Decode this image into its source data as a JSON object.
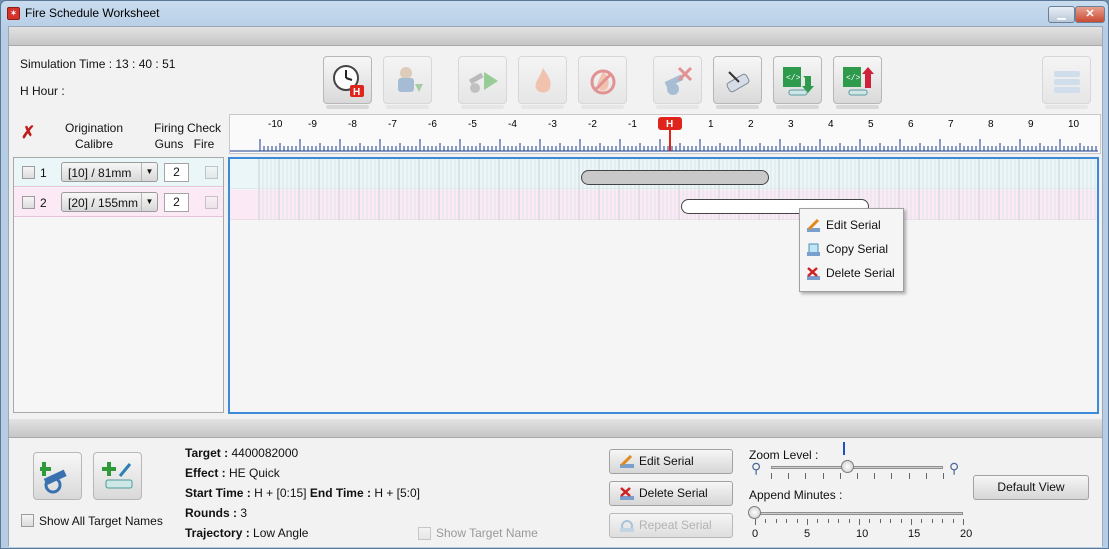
{
  "window": {
    "title": "Fire Schedule Worksheet"
  },
  "top_panel": {
    "simulation_time_label": "Simulation Time : 13 : 40 : 51",
    "h_hour_label": "H Hour :",
    "toolbar": [
      {
        "name": "h-hour-clock-button",
        "icon": "clock-h-icon",
        "enabled": true
      },
      {
        "name": "assign-observer-button",
        "icon": "soldier-download-icon",
        "enabled": false
      },
      {
        "name": "play-fire-button",
        "icon": "gun-play-icon",
        "enabled": false
      },
      {
        "name": "fire-button",
        "icon": "fire-icon",
        "enabled": false
      },
      {
        "name": "cease-fire-button",
        "icon": "no-fire-icon",
        "enabled": false
      },
      {
        "name": "cancel-gun-button",
        "icon": "gun-cancel-icon",
        "enabled": false
      },
      {
        "name": "edit-clear-button",
        "icon": "pencil-eraser-icon",
        "enabled": true
      },
      {
        "name": "xml-import-button",
        "icon": "xml-import-icon",
        "enabled": true
      },
      {
        "name": "xml-export-button",
        "icon": "xml-export-icon",
        "enabled": true
      },
      {
        "name": "layout-button",
        "icon": "layout-icon",
        "enabled": false
      }
    ]
  },
  "headers": {
    "origination": "Origination",
    "calibre": "Calibre",
    "firing": "Firing",
    "guns": "Guns",
    "check": "Check",
    "fire": "Fire"
  },
  "ruler": {
    "labels": [
      "-10",
      "-9",
      "-8",
      "-7",
      "-6",
      "-5",
      "-4",
      "-3",
      "-2",
      "-1",
      "",
      "1",
      "2",
      "3",
      "4",
      "5",
      "6",
      "7",
      "8",
      "9",
      "10"
    ],
    "h_marker": "H"
  },
  "rows": [
    {
      "num": "1",
      "calibre": "[10] / 81mm",
      "guns": "2",
      "serial_start": -2.2,
      "serial_end": 2.5
    },
    {
      "num": "2",
      "calibre": "[20] / 155mm",
      "guns": "2",
      "serial_start": 0.3,
      "serial_end": 5.0
    }
  ],
  "context_menu": {
    "edit": "Edit Serial",
    "copy": "Copy Serial",
    "delete": "Delete Serial"
  },
  "bottom_panel": {
    "show_all_target_names": "Show All Target Names",
    "target_label": "Target :",
    "target_value": "4400082000",
    "effect_label": "Effect :",
    "effect_value": "HE Quick",
    "start_time_label": "Start Time :",
    "start_time_value": "H + [0:15]",
    "end_time_label": "End Time :",
    "end_time_value": "H + [5:0]",
    "rounds_label": "Rounds :",
    "rounds_value": "3",
    "trajectory_label": "Trajectory :",
    "trajectory_value": "Low Angle",
    "show_target_name": "Show Target Name",
    "edit_serial": "Edit Serial",
    "delete_serial": "Delete Serial",
    "repeat_serial": "Repeat Serial",
    "zoom_level_label": "Zoom Level :",
    "zoom_level_fraction": 0.45,
    "append_minutes_label": "Append Minutes :",
    "append_minutes_value": 0,
    "append_ticks": [
      "0",
      "5",
      "10",
      "15",
      "20"
    ],
    "default_view": "Default View"
  },
  "colors": {
    "lane1": "#eaf6f8",
    "lane2": "#fbeaf5",
    "serial1": "#c9c9c9",
    "serial2": "#ffffff",
    "accent": "#3c8ad8",
    "h_marker": "#e0231b"
  }
}
